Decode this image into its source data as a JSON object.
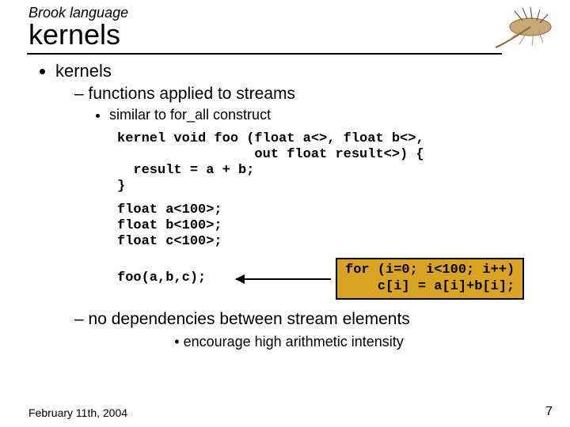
{
  "header": {
    "supertitle": "Brook language",
    "title": "kernels"
  },
  "bullets": {
    "lvl1_a": "kernels",
    "lvl2_a": "functions applied to streams",
    "lvl3_a": "similar to for_all construct",
    "lvl2_b": "no dependencies between stream elements",
    "lvl3_b": "encourage high arithmetic intensity"
  },
  "code": {
    "kernel": "kernel void foo (float a<>, float b<>,\n                 out float result<>) {\n  result = a + b;\n}",
    "decls": "float a<100>;\nfloat b<100>;\nfloat c<100>;",
    "call": "foo(a,b,c);",
    "forloop": "for (i=0; i<100; i++)\n    c[i] = a[i]+b[i];"
  },
  "footer": {
    "date": "February 11th, 2004",
    "page": "7"
  }
}
